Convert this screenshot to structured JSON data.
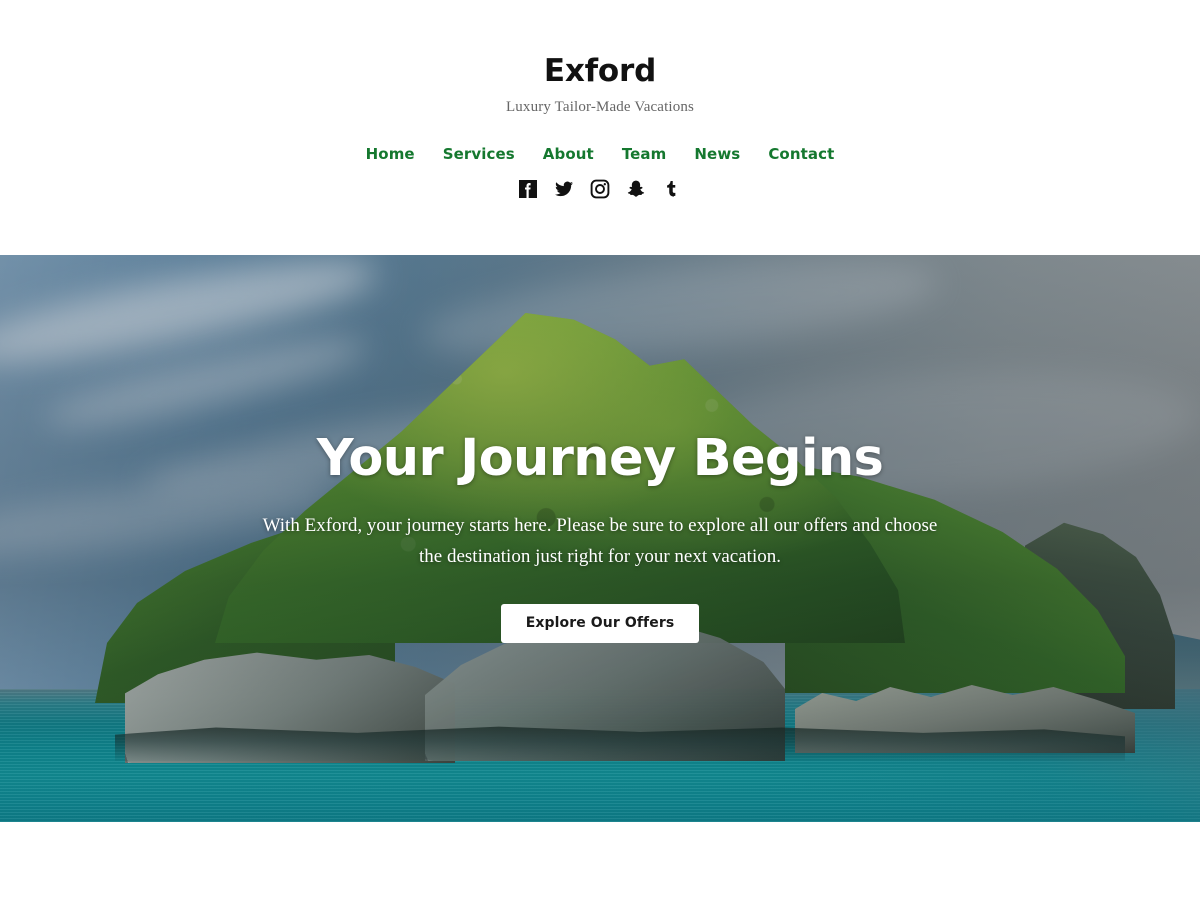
{
  "site": {
    "title": "Exford",
    "tagline": "Luxury Tailor-Made Vacations",
    "accent_color": "#15782f",
    "background_color": "#ffffff"
  },
  "nav": {
    "items": [
      {
        "label": "Home"
      },
      {
        "label": "Services"
      },
      {
        "label": "About"
      },
      {
        "label": "Team"
      },
      {
        "label": "News"
      },
      {
        "label": "Contact"
      }
    ]
  },
  "social": {
    "items": [
      {
        "name": "facebook-icon",
        "label": "Facebook"
      },
      {
        "name": "twitter-icon",
        "label": "Twitter"
      },
      {
        "name": "instagram-icon",
        "label": "Instagram"
      },
      {
        "name": "snapchat-icon",
        "label": "Snapchat"
      },
      {
        "name": "tumblr-icon",
        "label": "Tumblr"
      }
    ]
  },
  "hero": {
    "title": "Your Journey Begins",
    "text": "With Exford, your journey starts here. Please be sure to explore all our offers and choose the destination just right for your next vacation.",
    "cta_label": "Explore Our Offers",
    "image_description": "Tropical limestone island covered in green jungle rising from turquoise sea under a partly cloudy sky",
    "overlay_text_color": "#ffffff",
    "cta_background_color": "#ffffff",
    "cta_text_color": "#1a1a1a"
  }
}
